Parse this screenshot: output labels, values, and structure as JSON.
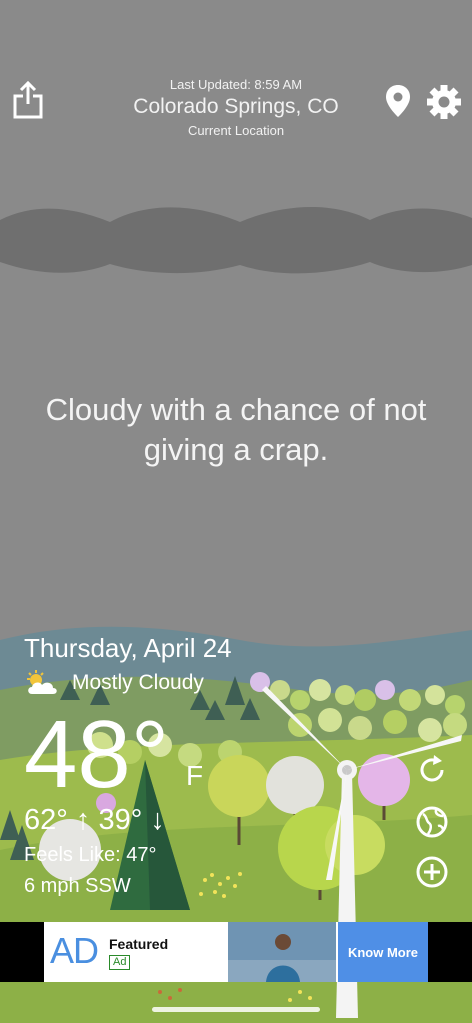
{
  "header": {
    "last_updated": "Last Updated: 8:59 AM",
    "city": "Colorado Springs, CO",
    "location_label": "Current Location"
  },
  "icons": {
    "share": "share-icon",
    "location": "location-pin-icon",
    "settings": "gear-icon",
    "condition": "partly-cloudy-icon",
    "refresh": "refresh-icon",
    "globe": "globe-icon",
    "add": "add-icon"
  },
  "tagline": {
    "line1": "Cloudy with a chance of not",
    "line2": "giving a crap."
  },
  "weather": {
    "date": "Thursday, April 24",
    "condition": "Mostly Cloudy",
    "temperature": "48°",
    "unit": "F",
    "hi_lo": "62° ↑ 39° ↓",
    "feels_like": "Feels Like: 47°",
    "wind": "6 mph SSW"
  },
  "ad": {
    "logo": "AD",
    "title": "Featured",
    "badge": "Ad",
    "cta": "Know More"
  },
  "colors": {
    "sky": "#8a8a8a",
    "cloud_band": "#6e6e6e",
    "grass": "#8db047",
    "ad_button": "#4f8fe6"
  }
}
